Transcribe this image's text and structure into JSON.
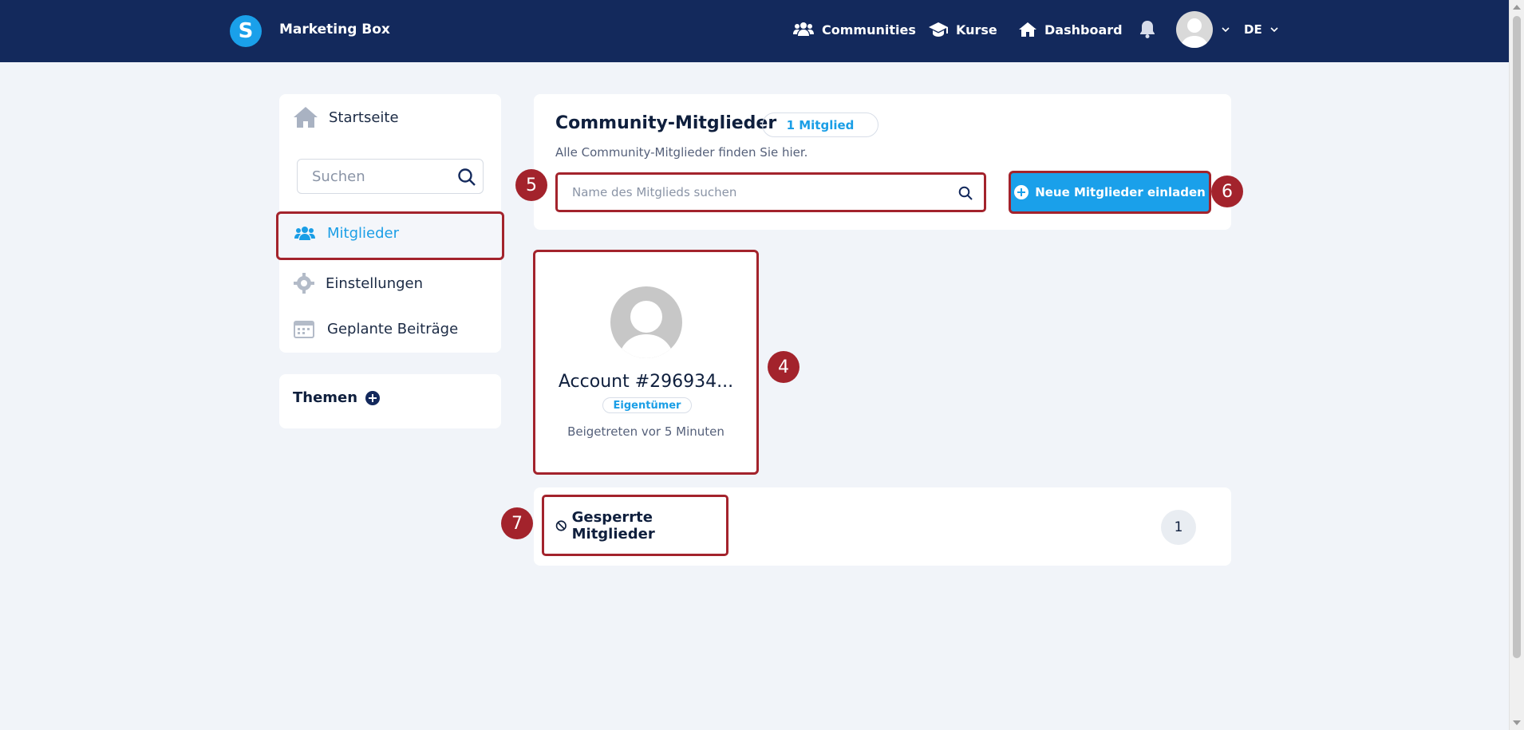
{
  "header": {
    "logo_letter": "S",
    "brand": "Marketing Box",
    "nav": [
      {
        "label": "Communities",
        "icon": "users-icon"
      },
      {
        "label": "Kurse",
        "icon": "graduation-cap-icon"
      },
      {
        "label": "Dashboard",
        "icon": "home-icon"
      }
    ],
    "language": "DE"
  },
  "sidebar": {
    "items": [
      {
        "label": "Startseite",
        "icon": "home-icon"
      },
      {
        "label": "Mitglieder",
        "icon": "users-icon",
        "active": true
      },
      {
        "label": "Einstellungen",
        "icon": "gear-icon"
      },
      {
        "label": "Geplante Beiträge",
        "icon": "calendar-icon"
      }
    ],
    "search_placeholder": "Suchen",
    "themen_label": "Themen"
  },
  "main": {
    "title": "Community-Mitglieder",
    "count_label": "1 Mitglied",
    "subtitle": "Alle Community-Mitglieder finden Sie hier.",
    "search_placeholder": "Name des Mitglieds suchen",
    "invite_label": "Neue Mitglieder einladen"
  },
  "member": {
    "name": "Account #296934...",
    "role": "Eigentümer",
    "joined": "Beigetreten vor 5 Minuten"
  },
  "blocked": {
    "label": "Gesperrte Mitglieder",
    "page": "1"
  },
  "annotations": [
    "4",
    "5",
    "6",
    "7"
  ],
  "colors": {
    "header_bg": "#13295c",
    "accent": "#1aa0ea",
    "highlight_border": "#a3232c",
    "page_bg": "#f1f4f9"
  }
}
